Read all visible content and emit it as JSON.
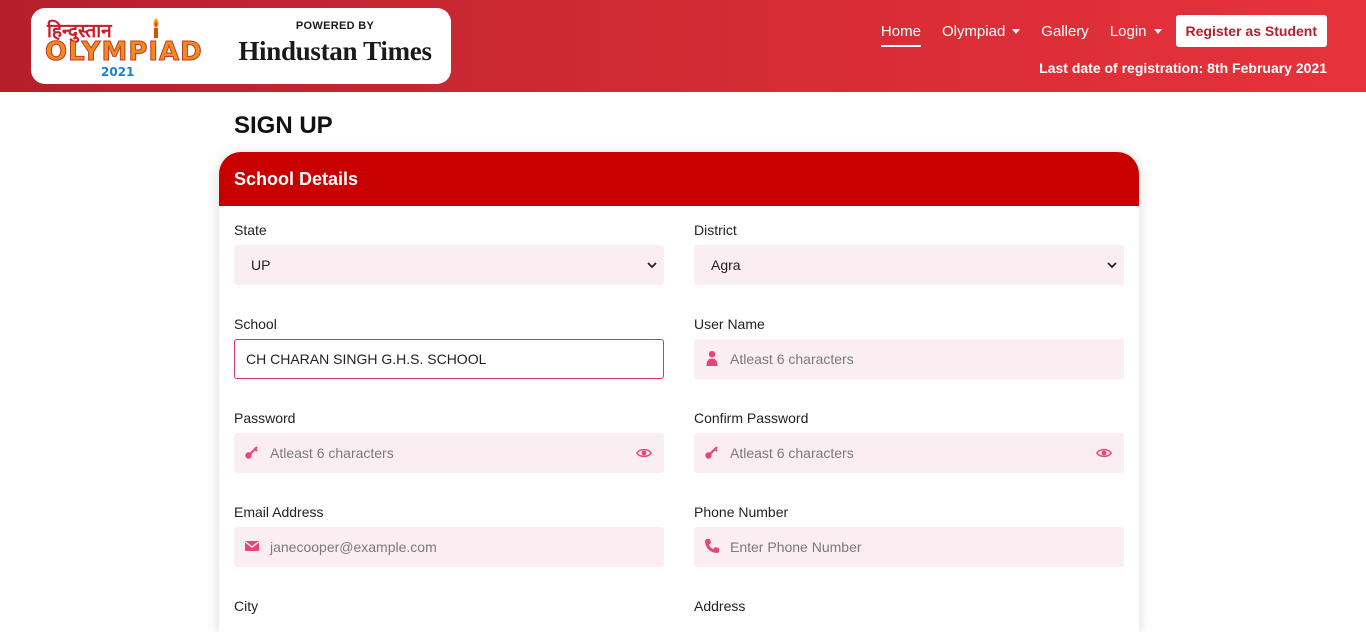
{
  "brand": {
    "hindi_name": "हिन्दुस्तान",
    "olympiad_text": "OLYMPIAD",
    "year": "2021",
    "powered_by": "POWERED BY",
    "partner": "Hindustan Times"
  },
  "nav": {
    "home": "Home",
    "olympiad": "Olympiad",
    "gallery": "Gallery",
    "login": "Login",
    "register": "Register as Student",
    "deadline": "Last date of registration: 8th February 2021"
  },
  "page": {
    "title": "SIGN UP"
  },
  "form": {
    "section_title": "School Details",
    "state": {
      "label": "State",
      "value": "UP"
    },
    "district": {
      "label": "District",
      "value": "Agra"
    },
    "school": {
      "label": "School",
      "value": "CH CHARAN SINGH G.H.S. SCHOOL"
    },
    "username": {
      "label": "User Name",
      "placeholder": "Atleast 6 characters",
      "icon": "user-icon"
    },
    "password": {
      "label": "Password",
      "placeholder": "Atleast 6 characters",
      "icon": "key-icon"
    },
    "confirm_password": {
      "label": "Confirm Password",
      "placeholder": "Atleast 6 characters",
      "icon": "key-icon"
    },
    "email": {
      "label": "Email Address",
      "placeholder": "janecooper@example.com",
      "icon": "envelope-icon"
    },
    "phone": {
      "label": "Phone Number",
      "placeholder": "Enter Phone Number",
      "icon": "phone-icon"
    },
    "city": {
      "label": "City"
    },
    "address": {
      "label": "Address"
    }
  },
  "colors": {
    "header_gradient_start": "#b51f2a",
    "header_gradient_end": "#e7323b",
    "section_header": "#c80000",
    "input_background": "#fbeef2",
    "icon_pink": "#e8457e",
    "focus_border": "#d63471"
  }
}
